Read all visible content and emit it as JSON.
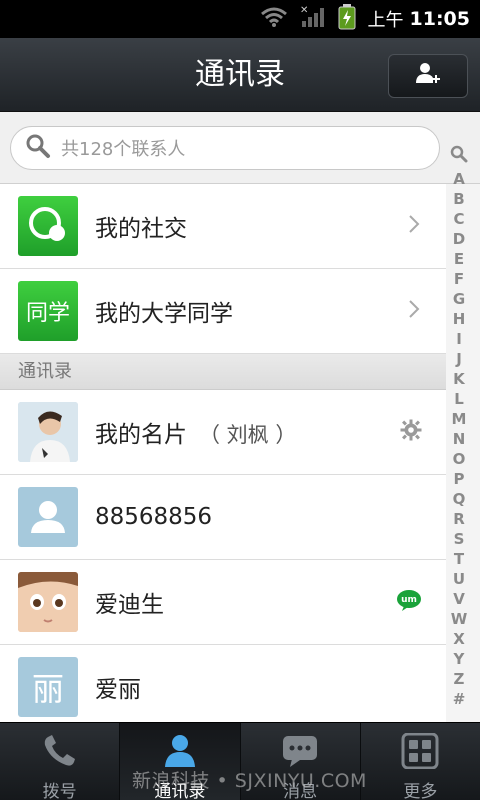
{
  "status_bar": {
    "ampm": "上午",
    "time": "11:05"
  },
  "header": {
    "title": "通讯录"
  },
  "search": {
    "placeholder": "共128个联系人"
  },
  "groups": [
    {
      "label": "我的社交"
    },
    {
      "label": "我的大学同学",
      "badge": "同学"
    }
  ],
  "section": {
    "title": "通讯录"
  },
  "contacts": [
    {
      "name": "我的名片",
      "subname": "（ 刘枫 ）"
    },
    {
      "name": "88568856"
    },
    {
      "name": "爱迪生",
      "badge": "um"
    },
    {
      "name": "爱丽",
      "avatar_text": "丽"
    }
  ],
  "alpha_index": [
    "A",
    "B",
    "C",
    "D",
    "E",
    "F",
    "G",
    "H",
    "I",
    "J",
    "K",
    "L",
    "M",
    "N",
    "O",
    "P",
    "Q",
    "R",
    "S",
    "T",
    "U",
    "V",
    "W",
    "X",
    "Y",
    "Z",
    "#"
  ],
  "bottom_nav": [
    {
      "label": "拨号",
      "icon": "phone-icon"
    },
    {
      "label": "通讯录",
      "icon": "contacts-icon"
    },
    {
      "label": "消息",
      "icon": "message-icon"
    },
    {
      "label": "更多",
      "icon": "more-icon"
    }
  ],
  "watermark": "新浪科技 • SJXINYU.COM",
  "colors": {
    "accent_green": "#2bb52b",
    "badge_green": "#1aa33a",
    "avatar_blue": "#a6c9dc"
  }
}
